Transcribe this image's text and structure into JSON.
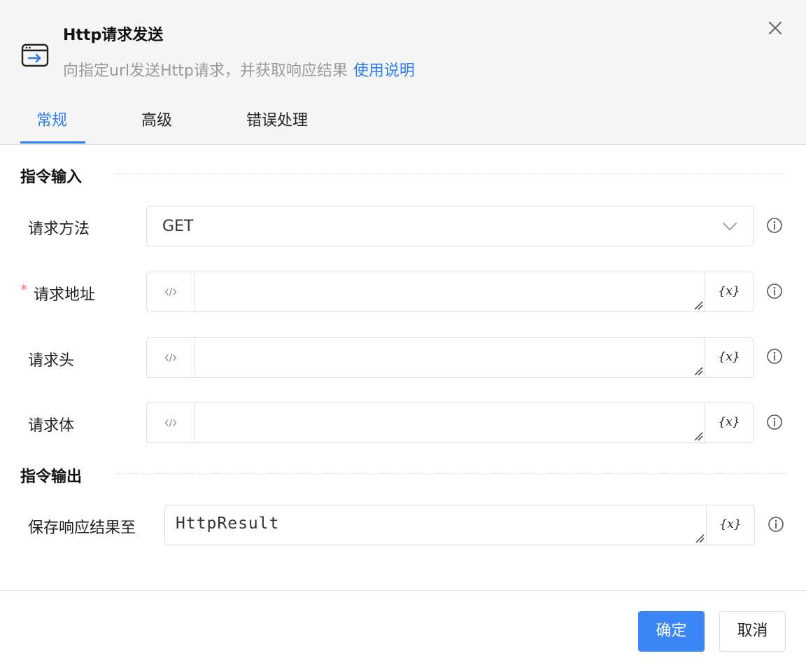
{
  "dialog": {
    "title": "Http请求发送",
    "subtitle": "向指定url发送Http请求，并获取响应结果",
    "help_link": "使用说明",
    "icon": "browser-arrow-icon",
    "close_icon": "close-icon"
  },
  "tabs": [
    {
      "label": "常规",
      "active": true
    },
    {
      "label": "高级",
      "active": false
    },
    {
      "label": "错误处理",
      "active": false
    }
  ],
  "input_section": {
    "title": "指令输入",
    "fields": {
      "method": {
        "label": "请求方法",
        "value": "GET",
        "required": false
      },
      "url": {
        "label": "请求地址",
        "value": "",
        "required": true,
        "required_mark": "*"
      },
      "headers": {
        "label": "请求头",
        "value": "",
        "required": false
      },
      "body": {
        "label": "请求体",
        "value": "",
        "required": false
      }
    },
    "variable_button_label": "{x}"
  },
  "output_section": {
    "title": "指令输出",
    "save_field": {
      "label": "保存响应结果至",
      "value": "HttpResult"
    },
    "variable_button_label": "{x}"
  },
  "footer": {
    "ok_label": "确定",
    "cancel_label": "取消"
  },
  "colors": {
    "accent": "#2d7cf6",
    "primary_button": "#3b86f7",
    "required": "#f56c6c",
    "header_bg": "#f5f5f5"
  }
}
